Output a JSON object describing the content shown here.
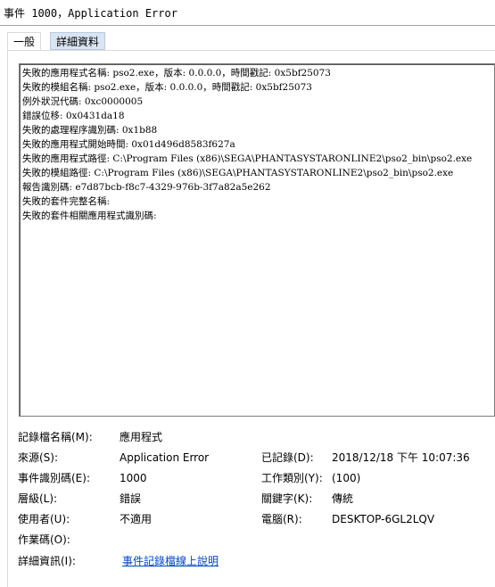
{
  "window": {
    "title": "事件 1000，Application Error"
  },
  "tabs": [
    {
      "label": "一般"
    },
    {
      "label": "詳細資料"
    }
  ],
  "description_lines": [
    "失敗的應用程式名稱: pso2.exe，版本: 0.0.0.0，時間戳記: 0x5bf25073",
    "失敗的模組名稱: pso2.exe，版本: 0.0.0.0，時間戳記: 0x5bf25073",
    "例外狀況代碼: 0xc0000005",
    "錯誤位移: 0x0431da18",
    "失敗的處理程序識別碼: 0x1b88",
    "失敗的應用程式開始時間: 0x01d496d8583f627a",
    "失敗的應用程式路徑: C:\\Program Files (x86)\\SEGA\\PHANTASYSTARONLINE2\\pso2_bin\\pso2.exe",
    "失敗的模組路徑: C:\\Program Files (x86)\\SEGA\\PHANTASYSTARONLINE2\\pso2_bin\\pso2.exe",
    "報告識別碼: e7d87bcb-f8c7-4329-976b-3f7a82a5e262",
    "失敗的套件完整名稱:",
    "失敗的套件相關應用程式識別碼:"
  ],
  "props": {
    "log_name_label": "記錄檔名稱(M):",
    "log_name_value": "應用程式",
    "source_label": "來源(S):",
    "source_value": "Application Error",
    "logged_label": "已記錄(D):",
    "logged_value": "2018/12/18 下午 10:07:36",
    "event_id_label": "事件識別碼(E):",
    "event_id_value": "1000",
    "task_category_label": "工作類別(Y):",
    "task_category_value": "(100)",
    "level_label": "層級(L):",
    "level_value": "錯誤",
    "keywords_label": "關鍵字(K):",
    "keywords_value": "傳統",
    "user_label": "使用者(U):",
    "user_value": "不適用",
    "computer_label": "電腦(R):",
    "computer_value": "DESKTOP-6GL2LQV",
    "opcode_label": "作業碼(O):",
    "more_info_label": "詳細資訊(I):",
    "more_info_link": "事件記錄檔線上說明"
  }
}
